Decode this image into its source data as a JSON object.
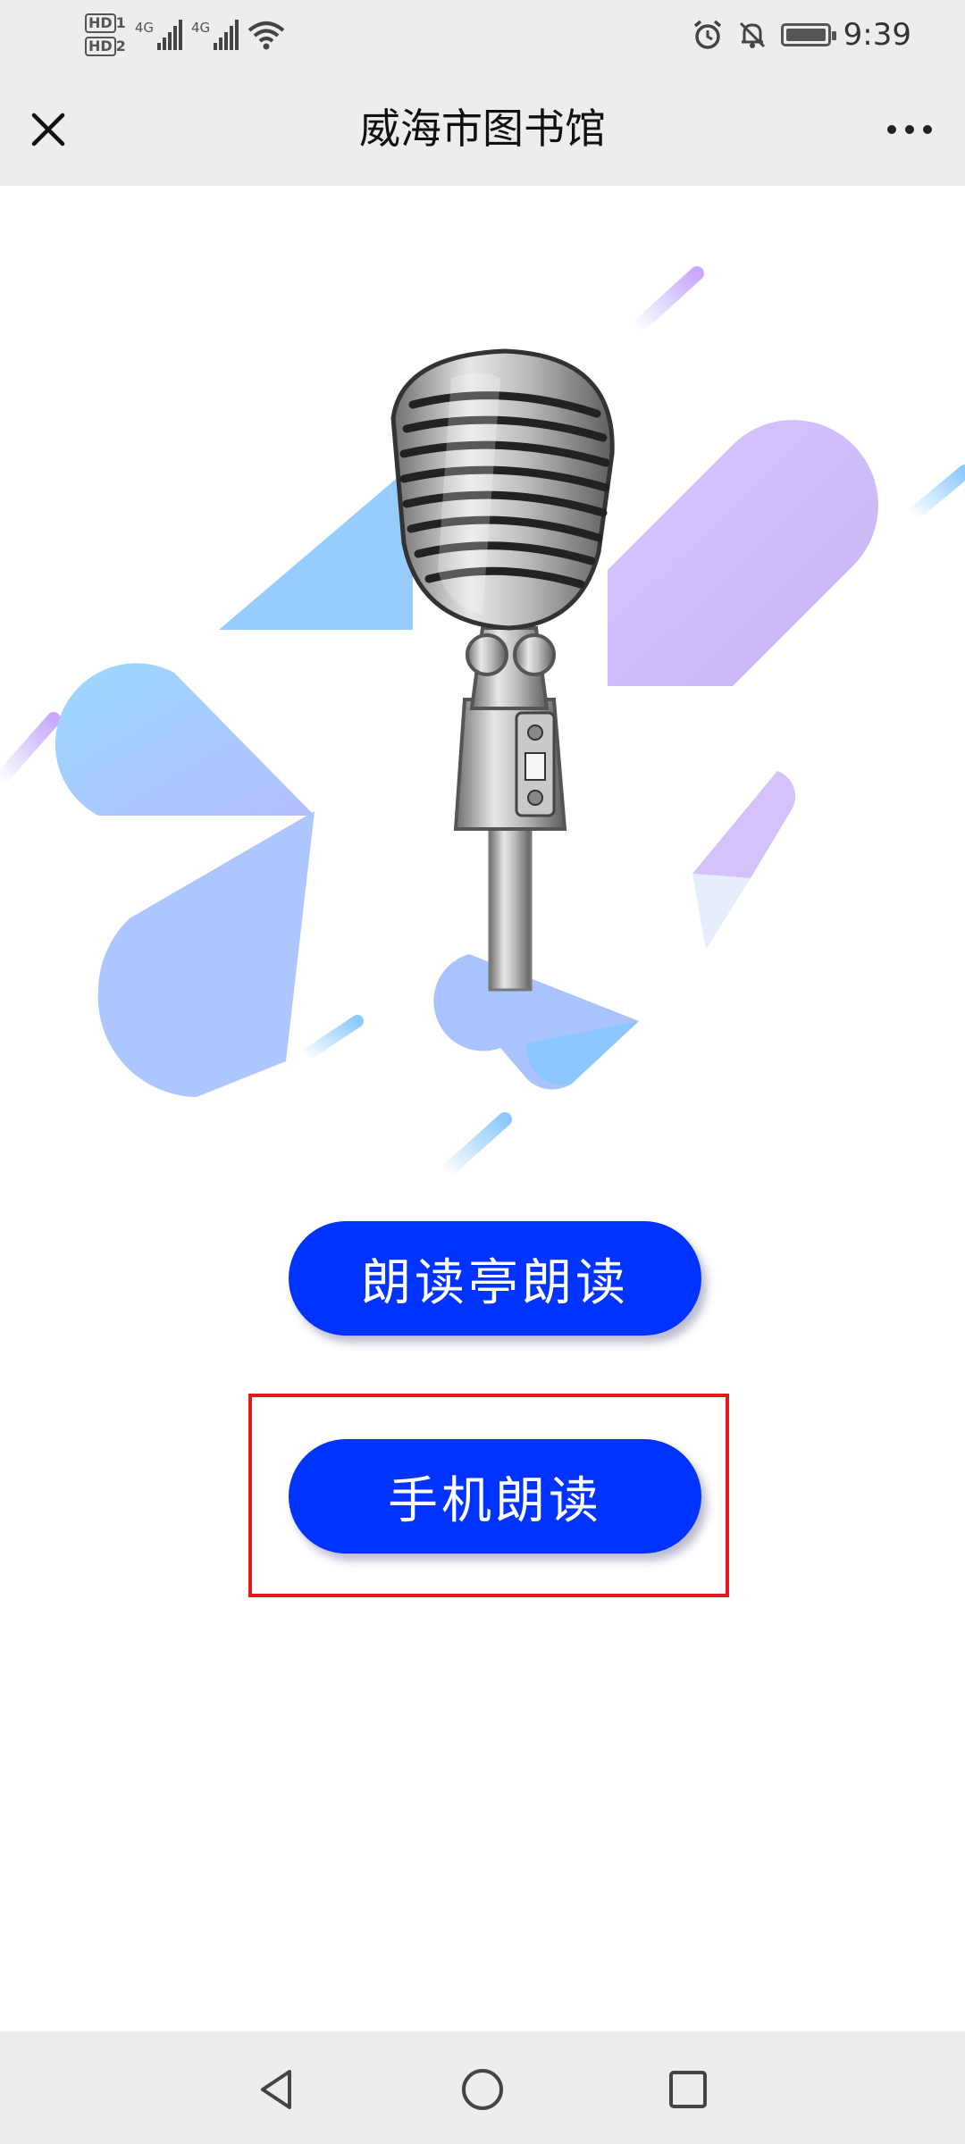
{
  "status_bar": {
    "hd1": "HD",
    "hd1_sub": "1",
    "hd2": "HD",
    "hd2_sub": "2",
    "network1": "4G",
    "network2": "4G",
    "time": "9:39",
    "icons": [
      "signal-icon",
      "wifi-icon",
      "alarm-icon",
      "bell-off-icon",
      "battery-icon"
    ]
  },
  "header": {
    "title": "威海市图书馆",
    "close_icon": "close-icon",
    "more_icon": "more-icon"
  },
  "main": {
    "illustration": "microphone-illustration",
    "buttons": [
      {
        "label": "朗读亭朗读"
      },
      {
        "label": "手机朗读"
      }
    ],
    "highlight_color": "#e8171b",
    "button_color": "#0033ff"
  },
  "bottom_nav": {
    "icons": [
      "back-icon",
      "home-icon",
      "recent-apps-icon"
    ]
  }
}
